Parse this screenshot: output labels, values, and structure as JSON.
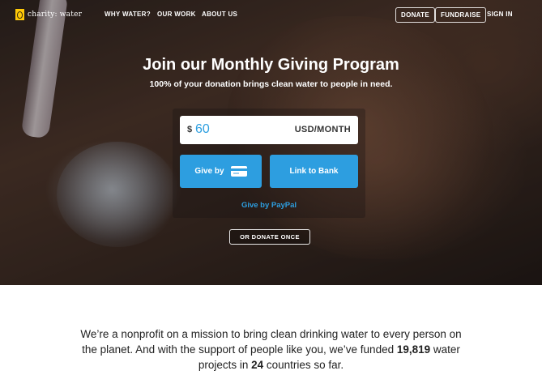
{
  "nav": {
    "logo_text": "charity: water",
    "links": [
      "WHY WATER?",
      "OUR WORK",
      "ABOUT US"
    ],
    "donate_label": "DONATE",
    "fundraise_label": "FUNDRAISE",
    "signin_label": "SIGN IN"
  },
  "hero": {
    "title": "Join our Monthly Giving Program",
    "subtitle": "100% of your donation brings clean water to people in need."
  },
  "donation": {
    "currency_symbol": "$",
    "amount": "60",
    "unit": "USD/MONTH",
    "give_by_label": "Give by",
    "card_icon": "credit-card-icon",
    "link_bank_label": "Link to Bank",
    "paypal_label": "Give by PayPal",
    "donate_once_label": "OR DONATE ONCE"
  },
  "mission": {
    "text_1": "We’re a nonprofit on a mission to bring clean drinking water to every person on the planet. And with the support of people like you, we’ve funded ",
    "projects": "19,819",
    "text_2": " water projects in ",
    "countries": "24",
    "text_3": " countries so far."
  },
  "colors": {
    "accent": "#2d9ee0",
    "logo_yellow": "#ffc907"
  }
}
